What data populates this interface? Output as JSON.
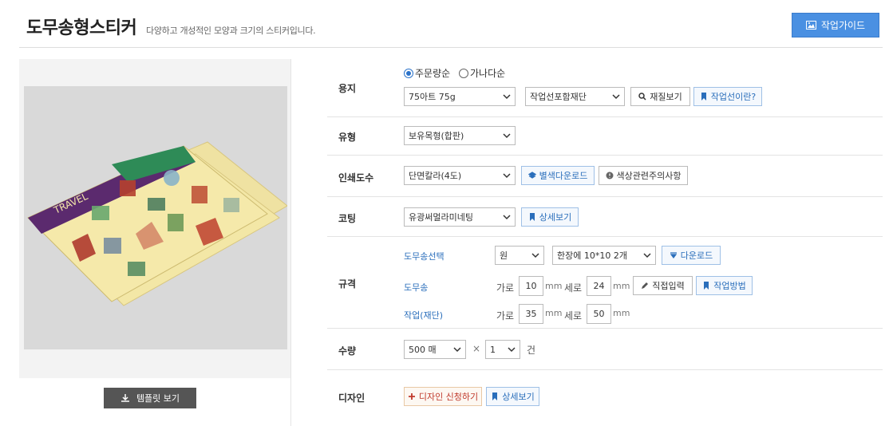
{
  "header": {
    "title": "도무송형스티커",
    "subtitle": "다양하고 개성적인 모양과 크기의 스티커입니다.",
    "guide_button": "작업가이드"
  },
  "left": {
    "template_button": "템플릿 보기",
    "image_texts": [
      "TRAVEL",
      "TRAVEL"
    ]
  },
  "paper": {
    "label": "용지",
    "sort_options": [
      {
        "label": "주문량순",
        "selected": true
      },
      {
        "label": "가나다순",
        "selected": false
      }
    ],
    "paper_select": "75아트 75g",
    "cut_select": "작업선포함재단",
    "material_button": "재질보기",
    "cutline_button": "작업선이란?"
  },
  "type": {
    "label": "유형",
    "select": "보유목형(합판)"
  },
  "print": {
    "label": "인쇄도수",
    "select": "단면칼라(4도)",
    "color_download_button": "별색다운로드",
    "caution_button": "색상관련주의사항"
  },
  "coating": {
    "label": "코팅",
    "select": "유광써멀라미네팅",
    "detail_button": "상세보기"
  },
  "spec": {
    "label": "규격",
    "select_label": "도무송선택",
    "shape_select": "원",
    "layout_select": "한장에 10*10 2개",
    "download_button": "다운로드",
    "domusong_label": "도무송",
    "domusong_width_label": "가로",
    "domusong_width": "10",
    "domusong_height_label": "세로",
    "domusong_height": "24",
    "unit": "mm",
    "direct_input_button": "직접입력",
    "method_button": "작업방법",
    "cut_label": "작업(재단)",
    "cut_width_label": "가로",
    "cut_width": "35",
    "cut_height_label": "세로",
    "cut_height": "50"
  },
  "quantity": {
    "label": "수량",
    "qty_select": "500 매",
    "times": "×",
    "count_select": "1",
    "unit": "건"
  },
  "design": {
    "label": "디자인",
    "apply_button": "디자인 신청하기",
    "detail_button": "상세보기"
  },
  "colors": {
    "accent_blue": "#4a90e2",
    "link_blue": "#2a6ebb",
    "sticker_sheet": "#f2e6a0",
    "sticker_purple": "#5b2a6e"
  }
}
